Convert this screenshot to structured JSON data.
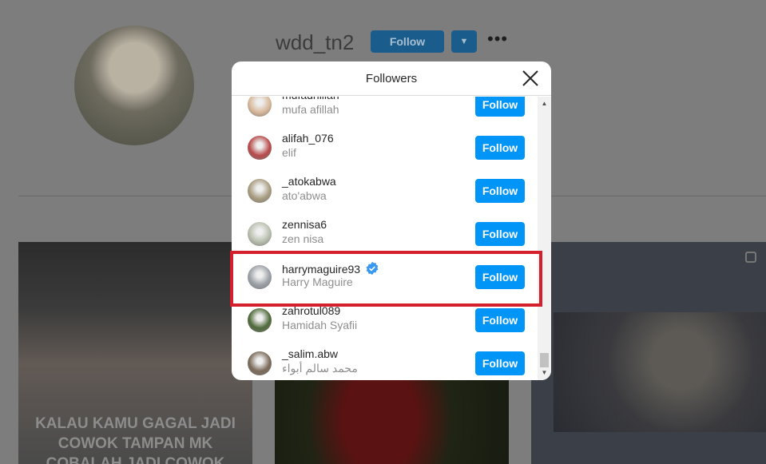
{
  "profile": {
    "username": "wdd_tn2",
    "follow_label": "Follow",
    "dropdown_icon": "chevron-down-icon",
    "more_icon": "more-dots-icon"
  },
  "posts": [
    {
      "caption": "KALAU KAMU GAGAL JADI COWOK TAMPAN MK COBALAH JADI COWOK"
    },
    {
      "caption": ""
    },
    {
      "caption": "",
      "icon": "multiple-photos-icon"
    }
  ],
  "modal": {
    "title": "Followers",
    "close_icon": "close-icon",
    "followers": [
      {
        "username": "mufadhillah",
        "full_name": "mufa afillah",
        "button": "Follow",
        "avatar_color": "#d8b89a",
        "verified": false
      },
      {
        "username": "alifah_076",
        "full_name": "elif",
        "button": "Follow",
        "avatar_color": "#b84a4a",
        "verified": false
      },
      {
        "username": "_atokabwa",
        "full_name": "ato'abwa",
        "button": "Follow",
        "avatar_color": "#a89c80",
        "verified": false
      },
      {
        "username": "zennisa6",
        "full_name": "zen nisa",
        "button": "Follow",
        "avatar_color": "#b8bfae",
        "verified": false
      },
      {
        "username": "harrymaguire93",
        "full_name": "Harry Maguire",
        "button": "Follow",
        "avatar_color": "#9aa0a6",
        "verified": true
      },
      {
        "username": "zahrotul089",
        "full_name": "Hamidah Syafii",
        "button": "Follow",
        "avatar_color": "#4f6a3a",
        "verified": false
      },
      {
        "username": "_salim.abw",
        "full_name": "محمد سالم أبواء",
        "button": "Follow",
        "avatar_color": "#7a6a5a",
        "verified": false
      }
    ]
  },
  "colors": {
    "follow_button": "#0095f6",
    "highlight_box": "#d3202c",
    "verified_badge": "#3897f0"
  }
}
